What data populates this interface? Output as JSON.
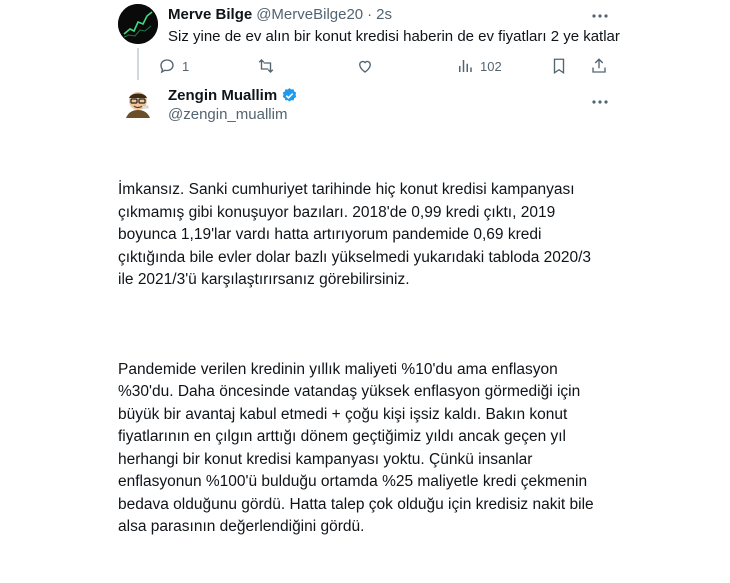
{
  "tweet1": {
    "author_name": "Merve Bilge",
    "handle": "@MerveBilge20",
    "separator": "·",
    "time": "2s",
    "text": "Siz yine de ev alın bir konut kredisi haberin de ev fiyatları 2 ye katlar",
    "replies": "1",
    "views": "102"
  },
  "tweet2": {
    "author_name": "Zengin Muallim",
    "handle": "@zengin_muallim",
    "paragraphs": [
      "İmkansız. Sanki cumhuriyet tarihinde hiç konut kredisi kampanyası çıkmamış gibi konuşuyor bazıları. 2018'de 0,99 kredi çıktı, 2019 boyunca 1,19'lar vardı hatta artırıyorum pandemide 0,69 kredi çıktığında bile evler dolar bazlı yükselmedi yukarıdaki tabloda 2020/3 ile 2021/3'ü karşılaştırırsanız görebilirsiniz.",
      "Pandemide verilen kredinin yıllık maliyeti %10'du ama enflasyon %30'du. Daha öncesinde vatandaş yüksek enflasyon görmediği için büyük bir avantaj kabul etmedi + çoğu kişi işsiz kaldı. Bakın konut fiyatlarının en çılgın arttığı dönem geçtiğimiz yıldı ancak geçen yıl herhangi bir konut kredisi kampanyası yoktu. Çünkü insanlar enflasyonun %100'ü bulduğu ortamda %25 maliyetle kredi çekmenin bedava olduğunu gördü. Hatta talep çok olduğu için kredisiz nakit bile alsa parasının değerlendiğini gördü."
    ]
  },
  "colors": {
    "text": "#0f1419",
    "secondary": "#536471",
    "verified": "#1d9bf0",
    "thread_line": "#cfd9de"
  },
  "icons": [
    "more-icon",
    "reply-icon",
    "retweet-icon",
    "like-icon",
    "views-icon",
    "verified-badge-icon"
  ]
}
